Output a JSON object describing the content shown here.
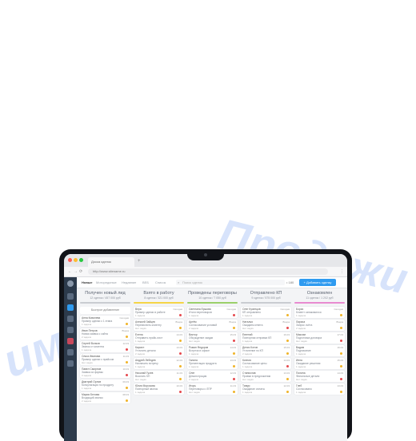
{
  "watermark": {
    "right": "Продажи",
    "left": "имр"
  },
  "browser": {
    "tab_title": "Доска сделок",
    "url": "http://www.sitename.ru",
    "nav_back": "←",
    "nav_forward": "→",
    "reload": "⟳",
    "menu": "⋮"
  },
  "topbar": {
    "items": [
      "Новые",
      "Моторединые",
      "Недавние",
      "ВЕБ",
      "Список"
    ],
    "search_placeholder": "Поиск сделок",
    "search_icon": "search-icon",
    "sum": "• 180",
    "add_button": "+ Добавить сделку"
  },
  "columns": [
    {
      "title": "Получен новый лид",
      "subtitle": "12 сделок / 457 000 руб",
      "color": "#c9ccd1",
      "add_label": "Быстрое добавление",
      "cards": [
        {
          "name": "Анна Ковалева",
          "date": "Сегодня",
          "desc": "Пример сделки с 1 этапа",
          "meta": "1 задача",
          "mark": "#f0b429"
        },
        {
          "name": "Иван Петров",
          "date": "Вчера",
          "desc": "Новая заявка с сайта",
          "meta": "2 задачи",
          "mark": "#f0b429"
        },
        {
          "name": "Сергей Волков",
          "date": "12.03",
          "desc": "Звонок от клиента",
          "meta": "1 задача",
          "mark": "#e5484d"
        },
        {
          "name": "Ольга Иванова",
          "date": "11.03",
          "desc": "Пример сделки с прайсом",
          "meta": "Нет задач",
          "mark": "#f0b429"
        },
        {
          "name": "Павел Смирнов",
          "date": "10.03",
          "desc": "Заявка из формы",
          "meta": "3 задачи",
          "mark": "#e5484d"
        },
        {
          "name": "Дмитрий Орлов",
          "date": "09.03",
          "desc": "Консультация по продукту",
          "meta": "1 задача",
          "mark": "#f0b429"
        },
        {
          "name": "Мария Белова",
          "date": "08.03",
          "desc": "Входящий звонок",
          "meta": "2 задачи",
          "mark": "#f0b429"
        }
      ]
    },
    {
      "title": "Взято в работу",
      "subtitle": "8 сделок / 321 000 руб",
      "color": "#f5d547",
      "add_label": "",
      "cards": [
        {
          "name": "Вера",
          "date": "Сегодня",
          "desc": "Пример сделки в работе",
          "meta": "1 задача",
          "mark": "#e5484d"
        },
        {
          "name": "Алексей Зайцев",
          "date": "Вчера",
          "desc": "Перезвонить клиенту",
          "meta": "Нет задач",
          "mark": "#f0b429"
        },
        {
          "name": "Елена",
          "date": "14.03",
          "desc": "Отправить прайс-лист",
          "meta": "1 задача",
          "mark": "#f0b429"
        },
        {
          "name": "Кирилл",
          "date": "13.03",
          "desc": "Уточнить детали",
          "meta": "2 задачи",
          "mark": "#e5484d"
        },
        {
          "name": "Андрей Лебедев",
          "date": "12.03",
          "desc": "Назначить встречу",
          "meta": "1 задача",
          "mark": "#f0b429"
        },
        {
          "name": "Николай Гусев",
          "date": "11.03",
          "desc": "Выслать КП",
          "meta": "Нет задач",
          "mark": "#f0b429"
        },
        {
          "name": "Юлия Морозова",
          "date": "10.03",
          "desc": "Повторный звонок",
          "meta": "1 задача",
          "mark": "#e5484d"
        }
      ]
    },
    {
      "title": "Проведены переговоры",
      "subtitle": "10 сделок / 7 050 руб",
      "color": "#9bd06a",
      "add_label": "",
      "cards": [
        {
          "name": "Светлана Ершова",
          "date": "Сегодня",
          "desc": "Итоги переговоров",
          "meta": "1 задача",
          "mark": "#e5484d"
        },
        {
          "name": "Артём",
          "date": "Вчера",
          "desc": "Согласование условий",
          "meta": "2 задачи",
          "mark": "#f0b429"
        },
        {
          "name": "Виктор",
          "date": "15.03",
          "desc": "Обсуждение скидки",
          "meta": "Нет задач",
          "mark": "#e5484d"
        },
        {
          "name": "Роман Федоров",
          "date": "14.03",
          "desc": "Встреча в офисе",
          "meta": "1 задача",
          "mark": "#f0b429"
        },
        {
          "name": "Галина",
          "date": "13.03",
          "desc": "Презентация продукта",
          "meta": "1 задача",
          "mark": "#f0b429"
        },
        {
          "name": "Олег",
          "date": "12.03",
          "desc": "Демонстрация",
          "meta": "2 задачи",
          "mark": "#e5484d"
        },
        {
          "name": "Игорь",
          "date": "11.03",
          "desc": "Переговоры с ЛПР",
          "meta": "Нет задач",
          "mark": "#f0b429"
        }
      ]
    },
    {
      "title": "Отправлено КП",
      "subtitle": "9 сделок / 575 000 руб",
      "color": "#c9ccd1",
      "add_label": "",
      "cards": [
        {
          "name": "Олег Кузнецов",
          "date": "Сегодня",
          "desc": "КП отправлено",
          "meta": "1 задача",
          "mark": "#f0b429"
        },
        {
          "name": "Наталья",
          "date": "Вчера",
          "desc": "Ожидаем ответа",
          "meta": "Нет задач",
          "mark": "#e5484d"
        },
        {
          "name": "Евгений",
          "date": "16.03",
          "desc": "Повторная отправка КП",
          "meta": "1 задача",
          "mark": "#f0b429"
        },
        {
          "name": "Денис Котов",
          "date": "15.03",
          "desc": "Уточнение по КП",
          "meta": "2 задачи",
          "mark": "#f0b429"
        },
        {
          "name": "Ксения",
          "date": "14.03",
          "desc": "Согласование цены",
          "meta": "1 задача",
          "mark": "#e5484d"
        },
        {
          "name": "Станислав",
          "date": "13.03",
          "desc": "Правки в предложении",
          "meta": "Нет задач",
          "mark": "#f0b429"
        },
        {
          "name": "Тимур",
          "date": "12.03",
          "desc": "Ожидание оплаты",
          "meta": "1 задача",
          "mark": "#f0b429"
        }
      ]
    },
    {
      "title": "Ознакомлен",
      "subtitle": "11 сделок / 1 202 руб",
      "color": "#e88bd0",
      "add_label": "",
      "cards": [
        {
          "name": "Борис",
          "date": "Сегодня",
          "desc": "Клиент ознакомился",
          "meta": "1 задача",
          "mark": "#f0b429"
        },
        {
          "name": "Лариса",
          "date": "Вчера",
          "desc": "Запрос счёта",
          "meta": "2 задачи",
          "mark": "#f0b429"
        },
        {
          "name": "Максим",
          "date": "17.03",
          "desc": "Подготовка договора",
          "meta": "Нет задач",
          "mark": "#e5484d"
        },
        {
          "name": "Вадим",
          "date": "16.03",
          "desc": "Подписание",
          "meta": "1 задача",
          "mark": "#f0b429"
        },
        {
          "name": "Инна",
          "date": "15.03",
          "desc": "Ожидание решения",
          "meta": "1 задача",
          "mark": "#f0b429"
        },
        {
          "name": "Полина",
          "date": "14.03",
          "desc": "Финальные детали",
          "meta": "Нет задач",
          "mark": "#e5484d"
        },
        {
          "name": "Глеб",
          "date": "13.03",
          "desc": "Согласовано",
          "meta": "1 задача",
          "mark": "#f0b429"
        }
      ]
    }
  ]
}
